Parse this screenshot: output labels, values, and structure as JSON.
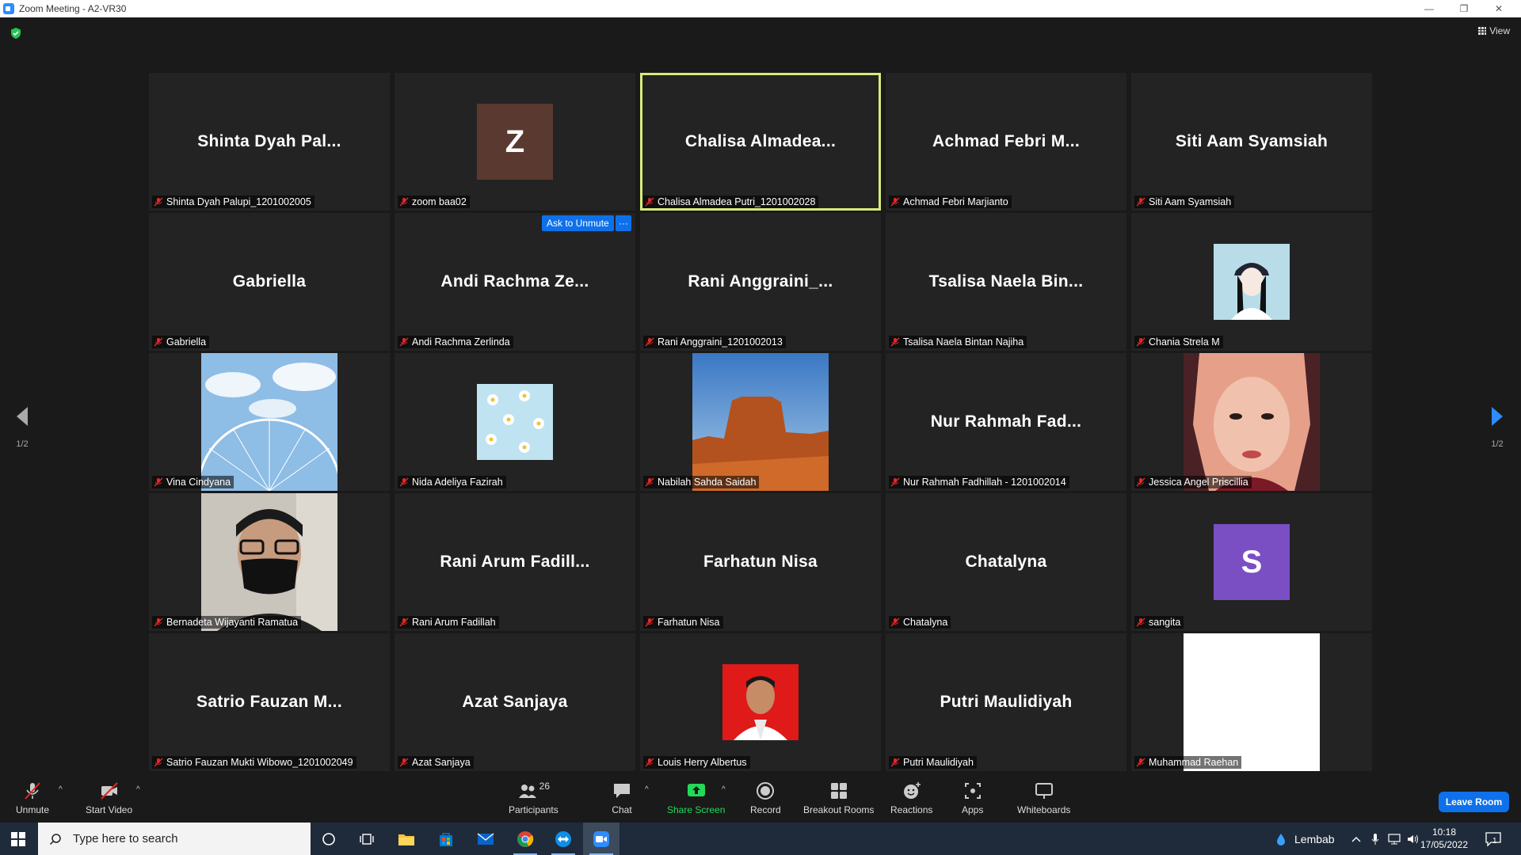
{
  "window": {
    "title": "Zoom Meeting - A2-VR30",
    "minimize": "—",
    "restore": "❐",
    "close": "✕"
  },
  "header": {
    "view_label": "View"
  },
  "ask_to_unmute": "Ask to Unmute",
  "more_label": "···",
  "page_indicator_left": "1/2",
  "page_indicator_right": "1/2",
  "tiles": [
    {
      "display": "Shinta Dyah Pal...",
      "tag": "Shinta Dyah Palupi_1201002005"
    },
    {
      "display": "Z",
      "tag": "zoom baa02",
      "avatar_color": "#5a3a30"
    },
    {
      "display": "Chalisa Almadea...",
      "tag": "Chalisa Almadea Putri_1201002028"
    },
    {
      "display": "Achmad Febri M...",
      "tag": "Achmad Febri Marjianto"
    },
    {
      "display": "Siti Aam Syamsiah",
      "tag": "Siti Aam Syamsiah"
    },
    {
      "display": "Gabriella",
      "tag": "Gabriella"
    },
    {
      "display": "Andi Rachma Ze...",
      "tag": "Andi Rachma Zerlinda"
    },
    {
      "display": "Rani Anggraini_...",
      "tag": "Rani Anggraini_1201002013"
    },
    {
      "display": "Tsalisa Naela Bin...",
      "tag": "Tsalisa Naela Bintan Najiha"
    },
    {
      "display": "",
      "tag": "Chania Strela M"
    },
    {
      "display": "",
      "tag": "Vina Cindyana"
    },
    {
      "display": "",
      "tag": "Nida Adeliya Fazirah"
    },
    {
      "display": "",
      "tag": "Nabilah Sahda Saidah"
    },
    {
      "display": "Nur Rahmah Fad...",
      "tag": "Nur Rahmah Fadhillah - 1201002014"
    },
    {
      "display": "",
      "tag": "Jessica Angel Priscillia"
    },
    {
      "display": "",
      "tag": "Bernadeta Wijayanti Ramatua"
    },
    {
      "display": "Rani Arum Fadill...",
      "tag": "Rani Arum Fadillah"
    },
    {
      "display": "Farhatun Nisa",
      "tag": "Farhatun Nisa"
    },
    {
      "display": "Chatalyna",
      "tag": "Chatalyna"
    },
    {
      "display": "S",
      "tag": "sangita",
      "avatar_color": "#7a4fc4"
    },
    {
      "display": "Satrio Fauzan M...",
      "tag": "Satrio Fauzan Mukti Wibowo_1201002049"
    },
    {
      "display": "Azat Sanjaya",
      "tag": "Azat Sanjaya"
    },
    {
      "display": "",
      "tag": "Louis Herry Albertus"
    },
    {
      "display": "Putri Maulidiyah",
      "tag": "Putri Maulidiyah"
    },
    {
      "display": "",
      "tag": "Muhammad Raehan"
    }
  ],
  "toolbar": {
    "unmute": "Unmute",
    "start_video": "Start Video",
    "participants": "Participants",
    "participants_count": "26",
    "chat": "Chat",
    "share_screen": "Share Screen",
    "record": "Record",
    "breakout_rooms": "Breakout Rooms",
    "reactions": "Reactions",
    "apps": "Apps",
    "whiteboards": "Whiteboards",
    "leave_room": "Leave Room"
  },
  "taskbar": {
    "search_placeholder": "Type here to search",
    "weather": "Lembab",
    "time": "10:18",
    "date": "17/05/2022",
    "notification_count": "1"
  },
  "colors": {
    "accent": "#0e71eb",
    "active_speaker": "#d6eb7a",
    "muted_red": "#e02828",
    "share_green": "#23d959"
  }
}
